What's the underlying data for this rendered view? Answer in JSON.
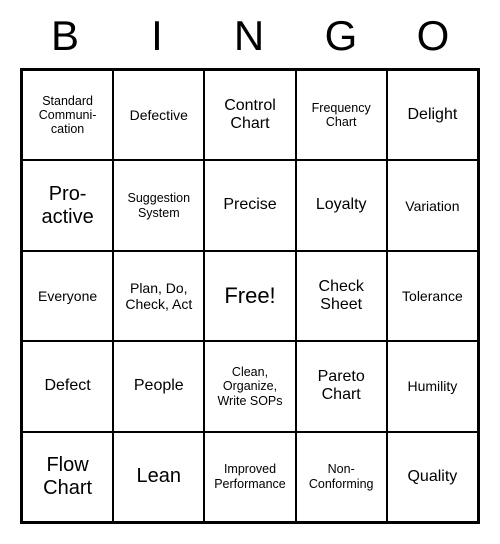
{
  "header": [
    "B",
    "I",
    "N",
    "G",
    "O"
  ],
  "cells": [
    [
      {
        "text": "Standard Communi-cation",
        "size": "small"
      },
      {
        "text": "Defective",
        "size": ""
      },
      {
        "text": "Control Chart",
        "size": "med"
      },
      {
        "text": "Frequency Chart",
        "size": "small"
      },
      {
        "text": "Delight",
        "size": "med"
      }
    ],
    [
      {
        "text": "Pro-active",
        "size": "big"
      },
      {
        "text": "Suggestion System",
        "size": "small"
      },
      {
        "text": "Precise",
        "size": "med"
      },
      {
        "text": "Loyalty",
        "size": "med"
      },
      {
        "text": "Variation",
        "size": ""
      }
    ],
    [
      {
        "text": "Everyone",
        "size": ""
      },
      {
        "text": "Plan, Do, Check, Act",
        "size": ""
      },
      {
        "text": "Free!",
        "size": "free"
      },
      {
        "text": "Check Sheet",
        "size": "med"
      },
      {
        "text": "Tolerance",
        "size": ""
      }
    ],
    [
      {
        "text": "Defect",
        "size": "med"
      },
      {
        "text": "People",
        "size": "med"
      },
      {
        "text": "Clean, Organize, Write SOPs",
        "size": "small"
      },
      {
        "text": "Pareto Chart",
        "size": "med"
      },
      {
        "text": "Humility",
        "size": ""
      }
    ],
    [
      {
        "text": "Flow Chart",
        "size": "big"
      },
      {
        "text": "Lean",
        "size": "big"
      },
      {
        "text": "Improved Performance",
        "size": "small"
      },
      {
        "text": "Non-Conforming",
        "size": "small"
      },
      {
        "text": "Quality",
        "size": "med"
      }
    ]
  ]
}
